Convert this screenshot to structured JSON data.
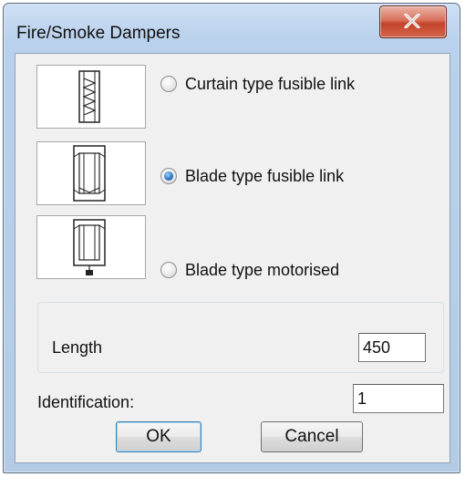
{
  "window": {
    "title": "Fire/Smoke Dampers"
  },
  "options": [
    {
      "label": "Curtain type fusible link",
      "checked": false,
      "icon": "curtain-damper-icon"
    },
    {
      "label": "Blade type fusible link",
      "checked": true,
      "icon": "blade-damper-icon"
    },
    {
      "label": "Blade type motorised",
      "checked": false,
      "icon": "motorised-damper-icon"
    }
  ],
  "length": {
    "label": "Length",
    "value": "450"
  },
  "identification": {
    "label": "Identification:",
    "value": "1"
  },
  "buttons": {
    "ok": "OK",
    "cancel": "Cancel"
  },
  "colors": {
    "title_bar": "#b9d1ec",
    "close_button": "#c2442c",
    "dialog_background": "#f0f0f0",
    "radio_selected": "#2b78c4"
  }
}
